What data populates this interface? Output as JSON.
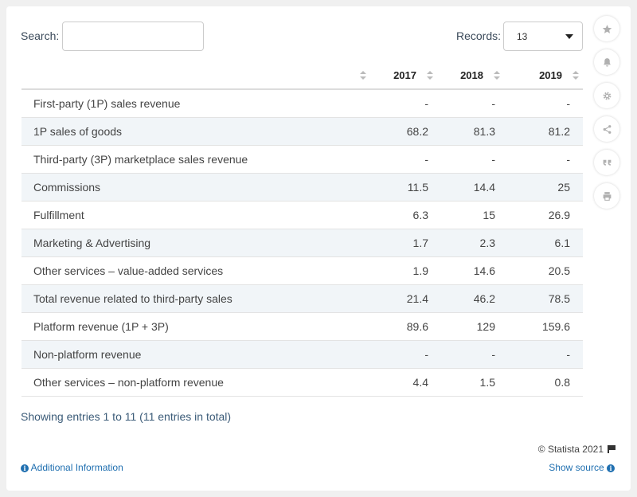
{
  "search": {
    "label": "Search:",
    "value": "",
    "placeholder": ""
  },
  "records": {
    "label": "Records:",
    "selected": "13"
  },
  "table": {
    "columns": [
      "",
      "2017",
      "2018",
      "2019"
    ],
    "rows": [
      {
        "label": "First-party (1P) sales revenue",
        "values": [
          "-",
          "-",
          "-"
        ]
      },
      {
        "label": "1P sales of goods",
        "values": [
          "68.2",
          "81.3",
          "81.2"
        ]
      },
      {
        "label": "Third-party (3P) marketplace sales revenue",
        "values": [
          "-",
          "-",
          "-"
        ]
      },
      {
        "label": "Commissions",
        "values": [
          "11.5",
          "14.4",
          "25"
        ]
      },
      {
        "label": "Fulfillment",
        "values": [
          "6.3",
          "15",
          "26.9"
        ]
      },
      {
        "label": "Marketing & Advertising",
        "values": [
          "1.7",
          "2.3",
          "6.1"
        ]
      },
      {
        "label": "Other services – value-added services",
        "values": [
          "1.9",
          "14.6",
          "20.5"
        ]
      },
      {
        "label": "Total revenue related to third-party sales",
        "values": [
          "21.4",
          "46.2",
          "78.5"
        ]
      },
      {
        "label": "Platform revenue (1P + 3P)",
        "values": [
          "89.6",
          "129",
          "159.6"
        ]
      },
      {
        "label": "Non-platform revenue",
        "values": [
          "-",
          "-",
          "-"
        ]
      },
      {
        "label": "Other services – non-platform revenue",
        "values": [
          "4.4",
          "1.5",
          "0.8"
        ]
      }
    ]
  },
  "footer": {
    "showing": "Showing entries 1 to 11 (11 entries in total)",
    "copyright": "© Statista 2021",
    "additional_info": "Additional Information",
    "show_source": "Show source"
  },
  "sidebar": {
    "icons": [
      "star-icon",
      "bell-icon",
      "gear-icon",
      "share-icon",
      "quote-icon",
      "print-icon"
    ]
  },
  "colors": {
    "link": "#1f6fb0",
    "row_stripe": "#f1f5f8",
    "icon": "#b0b0b0"
  }
}
